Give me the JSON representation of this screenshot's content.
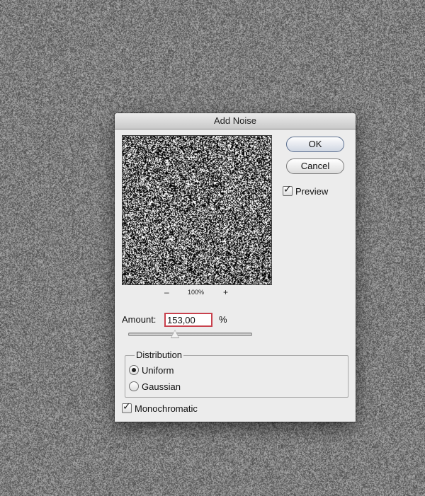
{
  "dialog": {
    "title": "Add Noise"
  },
  "preview": {
    "zoom_out_symbol": "–",
    "zoom_level": "100%",
    "zoom_in_symbol": "+"
  },
  "buttons": {
    "ok_label": "OK",
    "cancel_label": "Cancel"
  },
  "preview_toggle": {
    "label": "Preview",
    "checked": true
  },
  "amount": {
    "label": "Amount:",
    "value": "153,00",
    "unit": "%",
    "slider_fraction": 0.38
  },
  "distribution": {
    "legend": "Distribution",
    "options": [
      {
        "label": "Uniform",
        "selected": true
      },
      {
        "label": "Gaussian",
        "selected": false
      }
    ]
  },
  "monochromatic": {
    "label": "Monochromatic",
    "checked": true
  },
  "colors": {
    "desktop_noise_base": "#7d7d7d",
    "dialog_bg": "#ececec",
    "amount_field_border": "#c8414d"
  }
}
